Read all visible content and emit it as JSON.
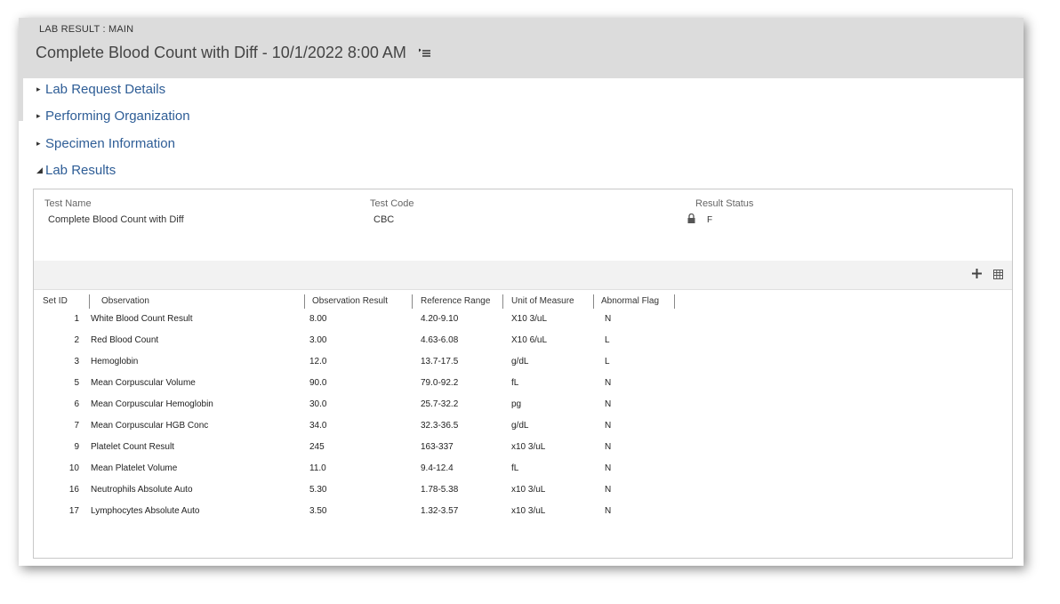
{
  "header": {
    "label": "LAB RESULT : MAIN",
    "title": "Complete Blood Count with Diff - 10/1/2022 8:00 AM"
  },
  "sections": [
    {
      "label": "Lab Request Details",
      "expanded": false
    },
    {
      "label": "Performing Organization",
      "expanded": false
    },
    {
      "label": "Specimen Information",
      "expanded": false
    },
    {
      "label": "Lab Results",
      "expanded": true
    }
  ],
  "test": {
    "name_label": "Test Name",
    "name_value": "Complete Blood Count with Diff",
    "code_label": "Test Code",
    "code_value": "CBC",
    "status_label": "Result Status",
    "status_value": "F"
  },
  "table": {
    "columns": [
      "Set ID",
      "Observation",
      "Observation Result",
      "Reference Range",
      "Unit of Measure",
      "Abnormal Flag"
    ],
    "rows": [
      [
        "1",
        "White Blood Count Result",
        "8.00",
        "4.20-9.10",
        "X10 3/uL",
        "N"
      ],
      [
        "2",
        "Red Blood Count",
        "3.00",
        "4.63-6.08",
        "X10 6/uL",
        "L"
      ],
      [
        "3",
        "Hemoglobin",
        "12.0",
        "13.7-17.5",
        "g/dL",
        "L"
      ],
      [
        "5",
        "Mean Corpuscular Volume",
        "90.0",
        "79.0-92.2",
        "fL",
        "N"
      ],
      [
        "6",
        "Mean Corpuscular Hemoglobin",
        "30.0",
        "25.7-32.2",
        "pg",
        "N"
      ],
      [
        "7",
        "Mean Corpuscular HGB Conc",
        "34.0",
        "32.3-36.5",
        "g/dL",
        "N"
      ],
      [
        "9",
        "Platelet Count Result",
        "245",
        "163-337",
        "x10 3/uL",
        "N"
      ],
      [
        "10",
        "Mean Platelet Volume",
        "11.0",
        "9.4-12.4",
        "fL",
        "N"
      ],
      [
        "16",
        "Neutrophils Absolute Auto",
        "5.30",
        "1.78-5.38",
        "x10 3/uL",
        "N"
      ],
      [
        "17",
        "Lymphocytes Absolute Auto",
        "3.50",
        "1.32-3.57",
        "x10 3/uL",
        "N"
      ]
    ]
  },
  "icons": {
    "menu": "list-menu-icon",
    "lock": "lock-icon",
    "add": "plus-icon",
    "grid": "grid-icon"
  },
  "colors": {
    "header_bg": "#dcdcdc",
    "link": "#2e5d96"
  }
}
